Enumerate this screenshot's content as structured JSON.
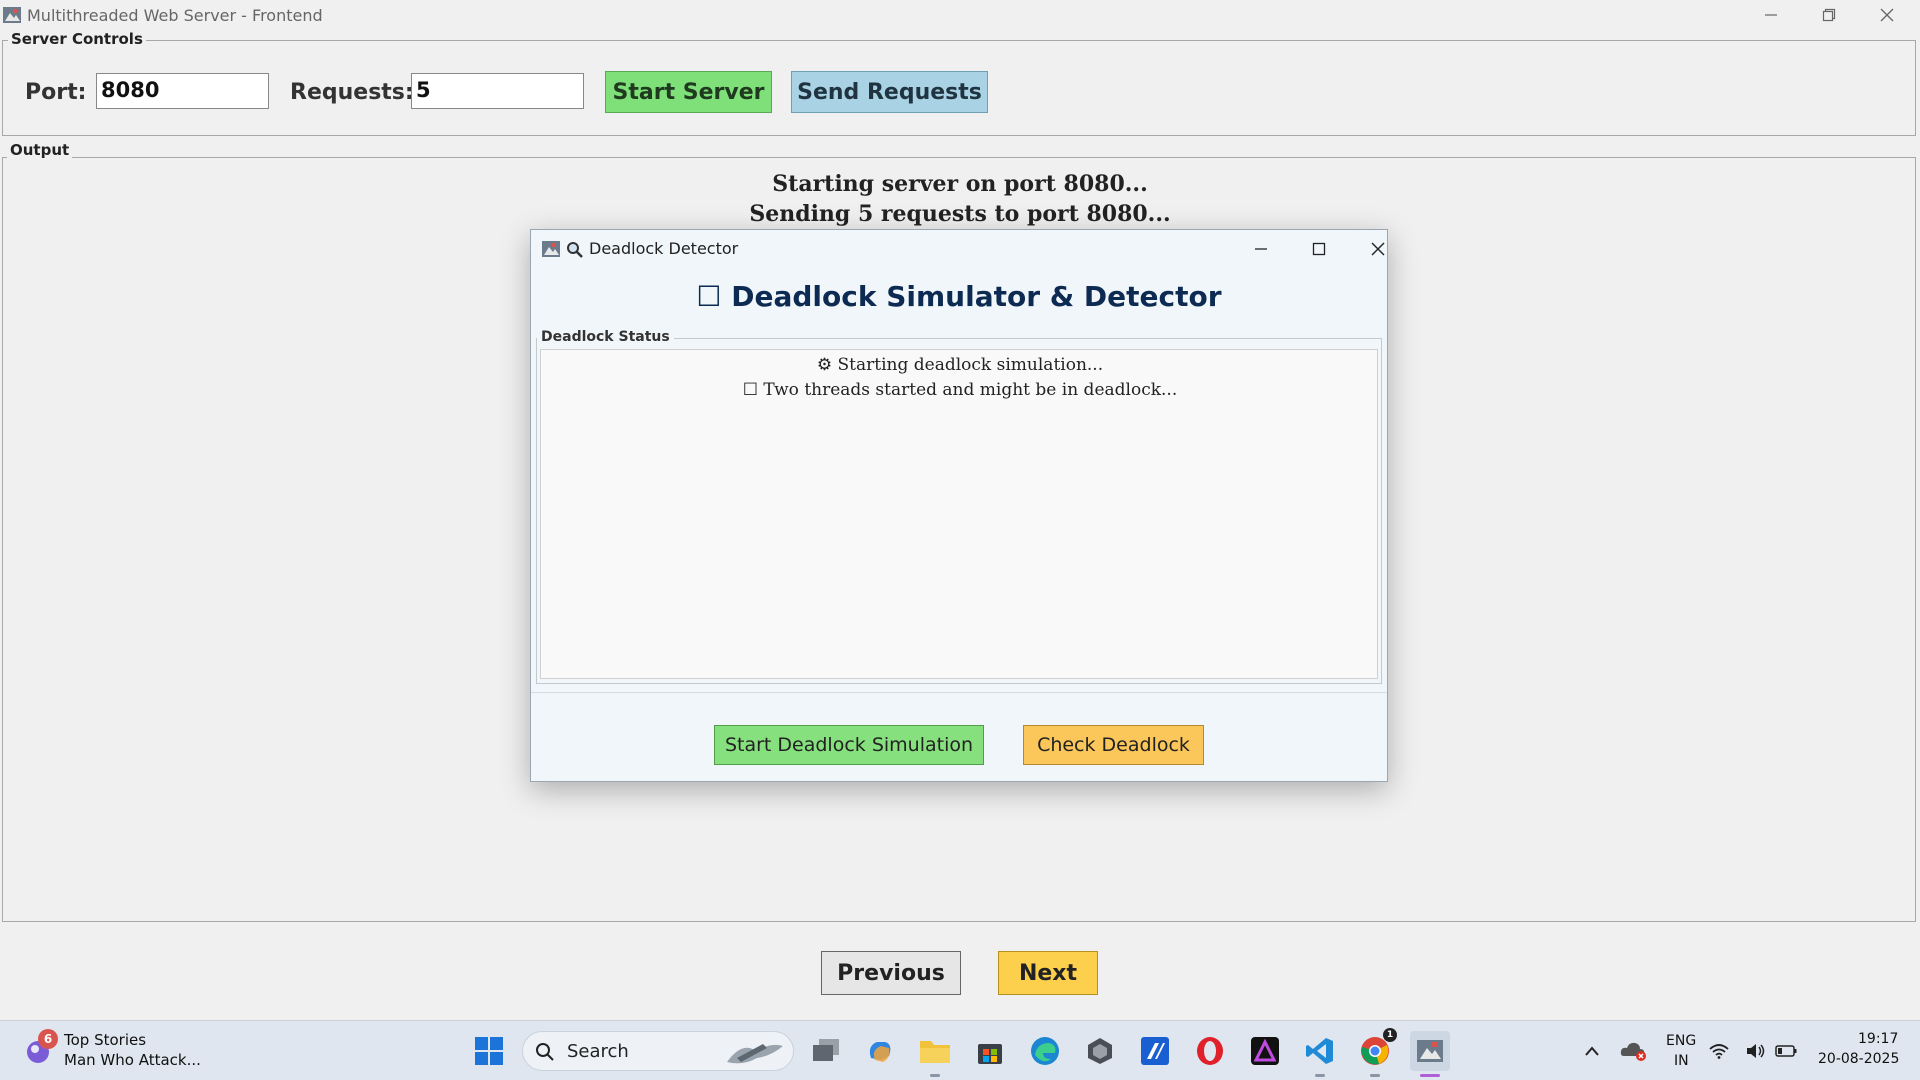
{
  "window": {
    "title": "Multithreaded Web Server - Frontend",
    "icons": [
      "app-icon",
      "minimize-icon",
      "restore-icon",
      "close-icon"
    ]
  },
  "server_controls": {
    "group_title": "Server Controls",
    "port_label": "Port:",
    "port_value": "8080",
    "requests_label": "Requests:",
    "requests_value": "5",
    "start_button": "Start Server",
    "send_button": "Send Requests"
  },
  "output": {
    "group_title": "Output",
    "lines": [
      "Starting server on port 8080...",
      "Sending 5 requests to port 8080..."
    ]
  },
  "nav": {
    "previous": "Previous",
    "next": "Next"
  },
  "dialog": {
    "title": "Deadlock Detector",
    "heading": "☐ Deadlock Simulator & Detector",
    "status_title": "Deadlock Status",
    "status_lines": [
      "⚙ Starting deadlock simulation...",
      "☐ Two threads started and might be in deadlock..."
    ],
    "simulate_button": "Start Deadlock Simulation",
    "check_button": "Check Deadlock"
  },
  "taskbar": {
    "news_badge": "6",
    "news_title": "Top Stories",
    "news_subtitle": "Man Who Attack...",
    "search_label": "Search",
    "lang_1": "ENG",
    "lang_2": "IN",
    "time": "19:17",
    "date": "20-08-2025",
    "chrome_badge": "1"
  },
  "colors": {
    "start_server_green": "#7fe07a",
    "send_requests_blue": "#a9d3e4",
    "next_yellow": "#fccf4d",
    "previous_gray": "#e6e6e6",
    "dlg_green": "#86e07d",
    "dlg_orange": "#fbc65a",
    "heading_navy": "#0d2b52"
  }
}
